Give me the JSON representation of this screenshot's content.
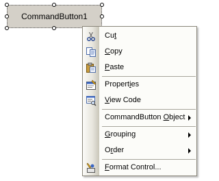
{
  "control": {
    "label": "CommandButton1"
  },
  "context_menu": {
    "items": [
      {
        "id": "cut",
        "pre": "Cu",
        "key": "t",
        "post": "",
        "icon": "scissors-icon"
      },
      {
        "id": "copy",
        "pre": "",
        "key": "C",
        "post": "opy",
        "icon": "copy-icon"
      },
      {
        "id": "paste",
        "pre": "",
        "key": "P",
        "post": "aste",
        "icon": "paste-icon"
      },
      {
        "id": "properties",
        "pre": "Propert",
        "key": "i",
        "post": "es",
        "icon": "properties-icon"
      },
      {
        "id": "view-code",
        "pre": "",
        "key": "V",
        "post": "iew Code",
        "icon": "view-code-icon"
      },
      {
        "id": "commandbutton-object",
        "pre": "CommandButton ",
        "key": "O",
        "post": "bject",
        "submenu": true
      },
      {
        "id": "grouping",
        "pre": "",
        "key": "G",
        "post": "rouping",
        "submenu": true
      },
      {
        "id": "order",
        "pre": "O",
        "key": "r",
        "post": "der",
        "submenu": true
      },
      {
        "id": "format-control",
        "pre": "",
        "key": "F",
        "post": "ormat Control...",
        "icon": "format-control-icon"
      }
    ]
  }
}
